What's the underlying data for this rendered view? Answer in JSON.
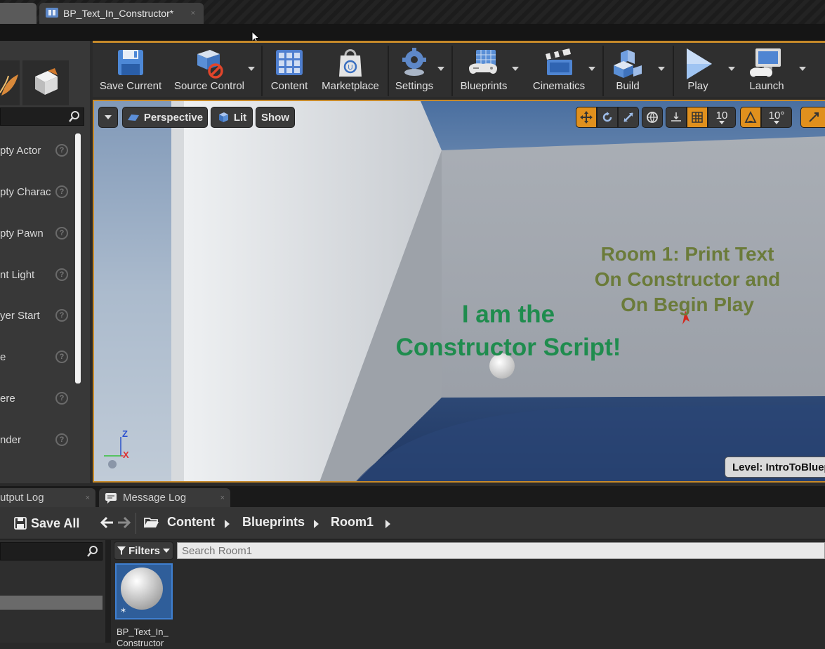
{
  "window": {
    "tab_title": "BP_Text_In_Constructor*",
    "tab_close": "×"
  },
  "modes_panel": {
    "items": [
      {
        "label": "pty Actor"
      },
      {
        "label": "pty Charac"
      },
      {
        "label": "pty Pawn"
      },
      {
        "label": "nt Light"
      },
      {
        "label": "yer Start"
      },
      {
        "label": "e"
      },
      {
        "label": "ere"
      },
      {
        "label": "nder"
      }
    ],
    "help_glyph": "?"
  },
  "toolbar": {
    "buttons": [
      {
        "label": "Save Current",
        "icon": "floppy-disk-icon"
      },
      {
        "label": "Source Control",
        "icon": "source-control-icon"
      },
      {
        "label": "Content",
        "icon": "grid-icon"
      },
      {
        "label": "Marketplace",
        "icon": "shopping-bag-icon"
      },
      {
        "label": "Settings",
        "icon": "gear-icon"
      },
      {
        "label": "Blueprints",
        "icon": "gamepad-icon"
      },
      {
        "label": "Cinematics",
        "icon": "clapperboard-icon"
      },
      {
        "label": "Build",
        "icon": "build-blocks-icon"
      },
      {
        "label": "Play",
        "icon": "play-icon"
      },
      {
        "label": "Launch",
        "icon": "monitor-gamepad-icon"
      }
    ]
  },
  "viewport": {
    "view_mode": "Perspective",
    "lighting_mode": "Lit",
    "show_label": "Show",
    "grid_snap_value": "10",
    "rotation_snap_value": "10°",
    "text_constructor": [
      "I am the",
      "Constructor Script!"
    ],
    "text_room": [
      "Room 1: Print Text",
      "On Constructor and",
      "On Begin Play"
    ],
    "level_label": "Level:  IntroToBlueprints",
    "axis_labels": {
      "z": "Z",
      "x": "X"
    },
    "colors": {
      "accent": "#c78a2a",
      "constructor_text": "#1f8c4e",
      "room_text": "#6b7b3a"
    }
  },
  "bottom": {
    "tabs": [
      {
        "label": "utput Log"
      },
      {
        "label": "Message Log"
      }
    ],
    "save_all": "Save All",
    "breadcrumb": [
      "Content",
      "Blueprints",
      "Room1"
    ],
    "filters_label": "Filters",
    "search_placeholder": "Search Room1",
    "asset": {
      "label_line1": "BP_Text_In_",
      "label_line2": "Constructor"
    }
  }
}
